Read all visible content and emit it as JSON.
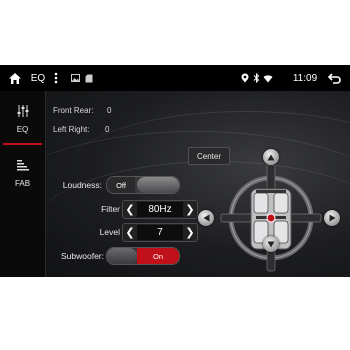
{
  "status_bar": {
    "title": "EQ",
    "time": "11:09",
    "icons": [
      "home-icon",
      "more-vert-icon",
      "image-icon",
      "sd-card-icon",
      "location-icon",
      "bluetooth-icon",
      "wifi-icon",
      "back-icon"
    ]
  },
  "sidebar": {
    "tabs": [
      {
        "label": "EQ",
        "icon": "equalizer-icon",
        "active": true
      },
      {
        "label": "FAB",
        "icon": "fader-balance-icon",
        "active": false
      }
    ]
  },
  "readouts": {
    "front_rear_label": "Front Rear:",
    "front_rear_value": "0",
    "left_right_label": "Left Right:",
    "left_right_value": "0"
  },
  "center_button": "Center",
  "controls": {
    "loudness": {
      "label": "Loudness:",
      "state": "Off"
    },
    "filter": {
      "label": "Filter",
      "value": "80Hz"
    },
    "level": {
      "label": "Level",
      "value": "7"
    },
    "subwoofer": {
      "label": "Subwoofer:",
      "state": "On"
    }
  },
  "colors": {
    "accent": "#c0101a",
    "background": "#141517",
    "status_bar": "#000000"
  }
}
